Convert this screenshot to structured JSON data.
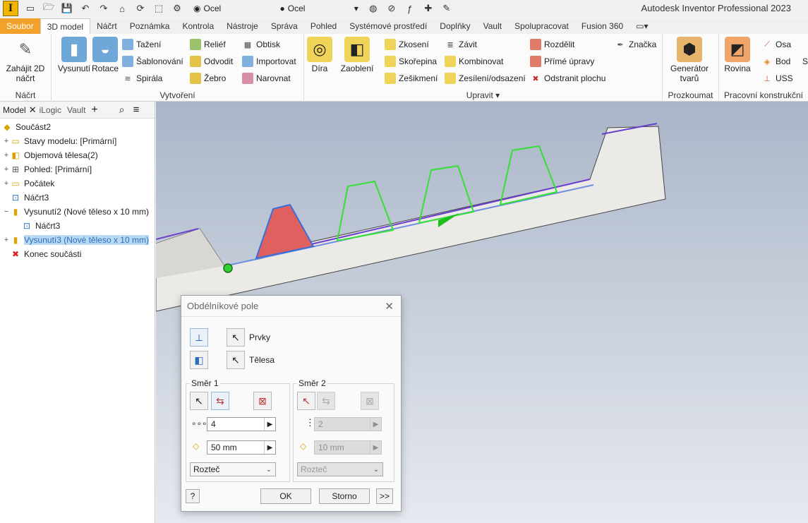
{
  "qat": {
    "material1": "Ocel",
    "material2": "Ocel",
    "app_title": "Autodesk Inventor Professional 2023"
  },
  "tabs": [
    "Soubor",
    "3D model",
    "Náčrt",
    "Poznámka",
    "Kontrola",
    "Nástroje",
    "Správa",
    "Pohled",
    "Systémové prostředí",
    "Doplňky",
    "Vault",
    "Spolupracovat",
    "Fusion 360"
  ],
  "ribbon": {
    "sketch": {
      "btn": "Zahájit 2D náčrt",
      "title": "Náčrt"
    },
    "create": {
      "extrude": "Vysunutí",
      "revolve": "Rotace",
      "sweep": "Tažení",
      "loft": "Šablonování",
      "coil": "Spirála",
      "emboss": "Reliéf",
      "derive": "Odvodit",
      "rib": "Žebro",
      "decal": "Obtisk",
      "import": "Importovat",
      "unwrap": "Narovnat",
      "title": "Vytvoření"
    },
    "modify": {
      "hole": "Díra",
      "fillet": "Zaoblení",
      "chamfer": "Zkosení",
      "shell": "Skořepina",
      "draft": "Zešikmení",
      "thread": "Závit",
      "combine": "Kombinovat",
      "thicken": "Zesílení/odsazení",
      "split": "Rozdělit",
      "direct": "Přímé úpravy",
      "delete_face": "Odstranit plochu",
      "mark": "Značka",
      "title": "Upravit"
    },
    "explore": {
      "btn": "Generátor tvarů",
      "title": "Prozkoumat"
    },
    "workfeatures": {
      "plane": "Rovina",
      "axis": "Osa",
      "point": "Bod",
      "ucs": "USS",
      "title": "Pracovní konstrukční",
      "cut": "S"
    }
  },
  "browser": {
    "tabs": [
      "Model",
      "iLogic",
      "Vault"
    ],
    "tree": [
      {
        "label": "Součást2"
      },
      {
        "label": "Stavy modelu: [Primární]"
      },
      {
        "label": "Objemová tělesa(2)"
      },
      {
        "label": "Pohled: [Primární]"
      },
      {
        "label": "Počátek"
      },
      {
        "label": "Náčrt3"
      },
      {
        "label": "Vysunutí2 (Nové těleso x 10 mm)"
      },
      {
        "label": "Náčrt3"
      },
      {
        "label": "Vysunutí3 (Nové těleso x 10 mm)"
      },
      {
        "label": "Konec součásti"
      }
    ]
  },
  "dialog": {
    "title": "Obdélníkové pole",
    "features_label": "Prvky",
    "bodies_label": "Tělesa",
    "dir1": {
      "label": "Směr 1",
      "count": "4",
      "distance": "50 mm",
      "method": "Rozteč"
    },
    "dir2": {
      "label": "Směr 2",
      "count": "2",
      "distance": "10 mm",
      "method": "Rozteč"
    },
    "ok": "OK",
    "cancel": "Storno",
    "more": ">>"
  }
}
